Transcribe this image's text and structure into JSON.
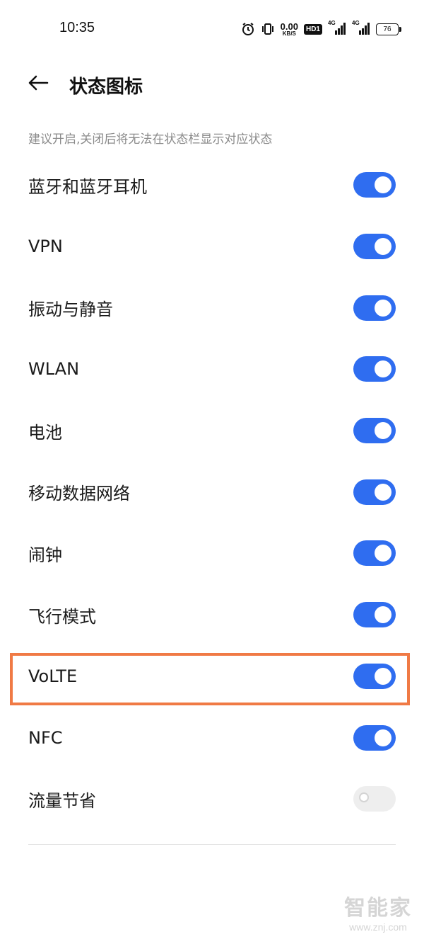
{
  "status_bar": {
    "time": "10:35",
    "net_speed_value": "0.00",
    "net_speed_unit": "KB/S",
    "hd_label": "HD1",
    "sim1_label": "4G",
    "sim2_label": "4G",
    "battery_level": "76",
    "icons": [
      "alarm-icon",
      "vibrate-icon",
      "signal-icon",
      "battery-icon"
    ]
  },
  "header": {
    "title": "状态图标",
    "back_icon": "arrow-left-icon"
  },
  "hint": "建议开启,关闭后将无法在状态栏显示对应状态",
  "settings": [
    {
      "label": "蓝牙和蓝牙耳机",
      "enabled": true
    },
    {
      "label": "VPN",
      "enabled": true
    },
    {
      "label": "振动与静音",
      "enabled": true
    },
    {
      "label": "WLAN",
      "enabled": true
    },
    {
      "label": "电池",
      "enabled": true
    },
    {
      "label": "移动数据网络",
      "enabled": true
    },
    {
      "label": "闹钟",
      "enabled": true
    },
    {
      "label": "飞行模式",
      "enabled": true
    },
    {
      "label": "VoLTE",
      "enabled": true,
      "highlighted": true
    },
    {
      "label": "NFC",
      "enabled": true
    },
    {
      "label": "流量节省",
      "enabled": false
    }
  ],
  "colors": {
    "toggle_on": "#2f6df0",
    "toggle_off": "#eeeeee",
    "highlight_border": "#f07a45"
  },
  "watermark": {
    "logo_text": "智能家",
    "url": "www.znj.com"
  }
}
